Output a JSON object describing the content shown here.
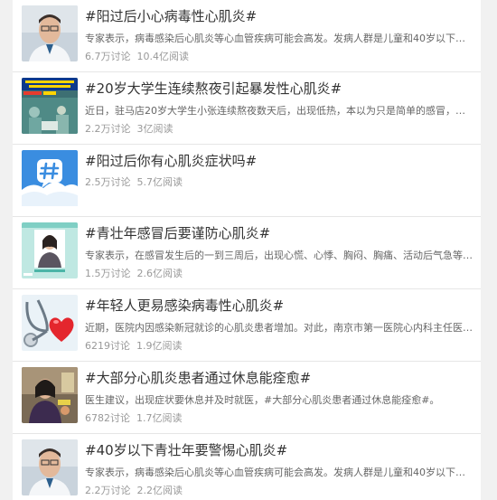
{
  "items": [
    {
      "title": "#阳过后小心病毒性心肌炎#",
      "desc": "专家表示，病毒感染后心肌炎等心血管疾病可能会高发。发病人群是儿童和40岁以下中青年...",
      "discuss": "6.7万讨论",
      "read": "10.4亿阅读",
      "thumb": "doctor-portrait"
    },
    {
      "title": "#20岁大学生连续熬夜引起暴发性心肌炎#",
      "desc": "近日，驻马店20岁大学生小张连续熬夜数天后，出现低热，本以为只是简单的感冒，没想到...",
      "discuss": "2.2万讨论",
      "read": "3亿阅读",
      "thumb": "hospital-news-image"
    },
    {
      "title": "#阳过后你有心肌炎症状吗#",
      "desc": "",
      "discuss": "2.5万讨论",
      "read": "5.7亿阅读",
      "thumb": "topic-hashtag-icon"
    },
    {
      "title": "#青壮年感冒后要谨防心肌炎#",
      "desc": "专家表示，在感冒发生后的一到三周后，出现心慌、心悸、胸闷、胸痛、活动后气急等情况...",
      "discuss": "1.5万讨论",
      "read": "2.6亿阅读",
      "thumb": "woman-video-image"
    },
    {
      "title": "#年轻人更易感染病毒性心肌炎#",
      "desc": "近期，医院内因感染新冠就诊的心肌炎患者增加。对此，南京市第一医院心内科主任医师张...",
      "discuss": "6219讨论",
      "read": "1.9亿阅读",
      "thumb": "stethoscope-heart-image"
    },
    {
      "title": "#大部分心肌炎患者通过休息能痊愈#",
      "desc": "医生建议，出现症状要休息并及时就医，#大部分心肌炎患者通过休息能痊愈#。",
      "discuss": "6782讨论",
      "read": "1.7亿阅读",
      "thumb": "woman-speaking-image"
    },
    {
      "title": "#40岁以下青壮年要警惕心肌炎#",
      "desc": "专家表示，病毒感染后心肌炎等心血管疾病可能会高发。发病人群是儿童和40岁以下中青年...",
      "discuss": "2.2万讨论",
      "read": "2.2亿阅读",
      "thumb": "doctor-portrait"
    }
  ]
}
